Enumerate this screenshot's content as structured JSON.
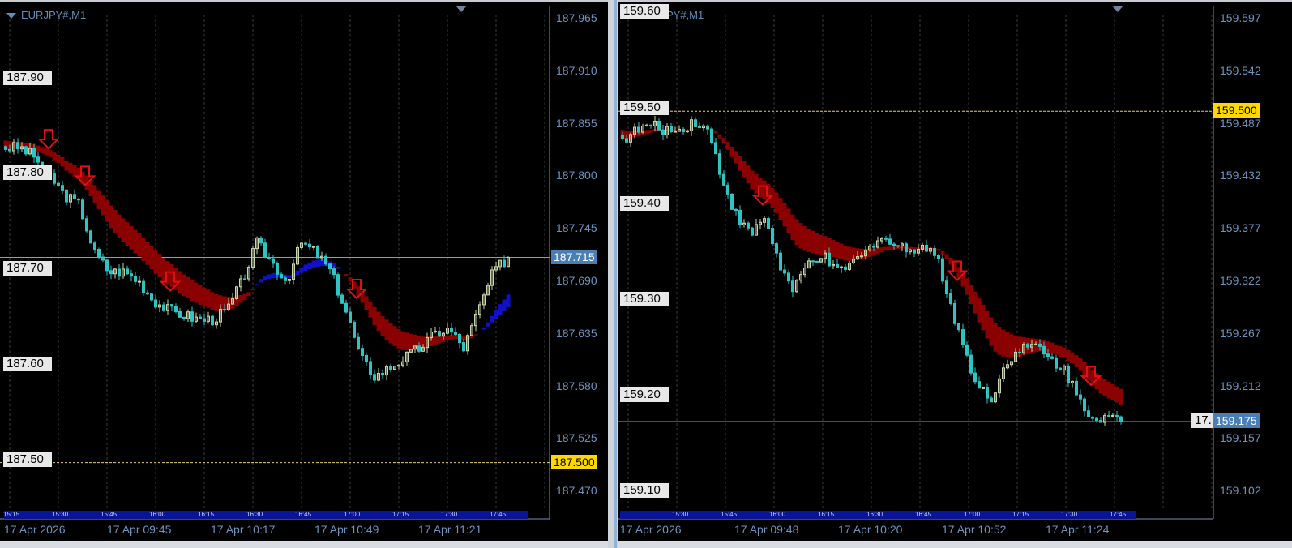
{
  "charts": [
    {
      "title": "EURJPY#,M1",
      "axis_ticks": [
        "187.965",
        "187.910",
        "187.855",
        "187.800",
        "187.745",
        "187.690",
        "187.635",
        "187.580",
        "187.525",
        "187.470"
      ],
      "levels": [
        "187.90",
        "187.80",
        "187.70",
        "187.60",
        "187.50"
      ],
      "bid_label": "187.715",
      "alert_label": "187.500",
      "strip_times": [
        "15:15",
        "15:30",
        "15:45",
        "16:00",
        "16:15",
        "16:30",
        "16:45",
        "17:00",
        "17:15",
        "17:30",
        "17:45"
      ],
      "dates": [
        "17 Apr 2026",
        "17 Apr 09:45",
        "17 Apr 10:17",
        "17 Apr 10:49",
        "17 Apr 11:21"
      ]
    },
    {
      "title": "USDJPY#,M1",
      "axis_ticks": [
        "159.597",
        "159.542",
        "159.487",
        "159.432",
        "159.377",
        "159.322",
        "159.267",
        "159.212",
        "159.157",
        "159.102"
      ],
      "levels": [
        "159.60",
        "159.50",
        "159.40",
        "159.30",
        "159.20",
        "159.10"
      ],
      "bid_label": "159.175",
      "alert_label": "159.500",
      "extra_label": "17.",
      "strip_times": [
        "15:30",
        "15:45",
        "16:00",
        "16:15",
        "16:30",
        "16:45",
        "17:00",
        "17:15",
        "17:30",
        "17:45"
      ],
      "dates": [
        "17 Apr 2026",
        "17 Apr 09:48",
        "17 Apr 10:20",
        "17 Apr 10:52",
        "17 Apr 11:24"
      ]
    }
  ],
  "chart_data": [
    {
      "type": "candlestick",
      "symbol": "EURJPY#,M1",
      "ylim": [
        187.47,
        187.965
      ],
      "bars": 125,
      "close_path": [
        187.83,
        187.83,
        187.82,
        187.8,
        187.78,
        187.77,
        187.72,
        187.7,
        187.7,
        187.69,
        187.67,
        187.66,
        187.655,
        187.65,
        187.65,
        187.66,
        187.69,
        187.73,
        187.71,
        187.69,
        187.73,
        187.72,
        187.7,
        187.66,
        187.61,
        187.59,
        187.6,
        187.61,
        187.62,
        187.635,
        187.64,
        187.62,
        187.66,
        187.7,
        187.715
      ],
      "bid": 187.715,
      "alert": 187.5,
      "sell_arrow_bars": [
        11,
        20,
        41,
        87
      ],
      "colors": {
        "bull": "#c8d6a8",
        "bear": "#2ec4c4",
        "band_down": "#8b0000",
        "band_up": "#1010c8"
      }
    },
    {
      "type": "candlestick",
      "symbol": "USDJPY#,M1",
      "ylim": [
        159.102,
        159.597
      ],
      "bars": 124,
      "close_path": [
        159.47,
        159.48,
        159.485,
        159.48,
        159.48,
        159.49,
        159.48,
        159.43,
        159.39,
        159.37,
        159.39,
        159.34,
        159.31,
        159.34,
        159.35,
        159.33,
        159.34,
        159.35,
        159.37,
        159.36,
        159.355,
        159.36,
        159.35,
        159.3,
        159.25,
        159.21,
        159.2,
        159.24,
        159.25,
        159.255,
        159.24,
        159.23,
        159.2,
        159.18,
        159.18,
        159.175
      ],
      "bid": 159.175,
      "alert": 159.5,
      "sell_arrow_bars": [
        35,
        83,
        116
      ],
      "colors": {
        "bull": "#c8d6a8",
        "bear": "#2ec4c4",
        "band_down": "#8b0000",
        "band_up": "#1010c8"
      }
    }
  ]
}
